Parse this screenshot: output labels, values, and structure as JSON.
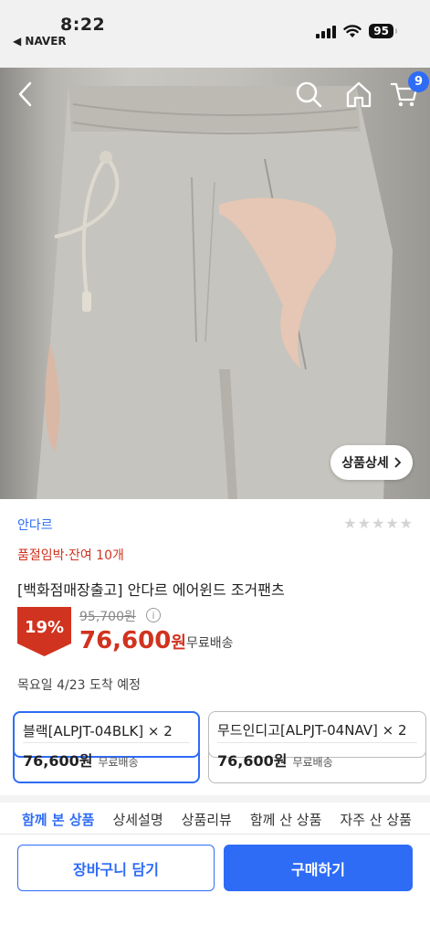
{
  "status_bar": {
    "time": "8:22",
    "back_app": "◀ NAVER",
    "battery": "95"
  },
  "nav": {
    "cart_count": "9",
    "detail_label": "상품상세"
  },
  "product": {
    "brand": "안다르",
    "stock_notice": "품절임박·잔여 10개",
    "title": "[백화점매장출고] 안다르 에어윈드 조거팬츠",
    "discount": "19%",
    "original_price": "95,700원",
    "sale_price_number": "76,600",
    "sale_price_unit": "원",
    "shipping": "무료배송",
    "delivery": "목요일 4/23 도착 예정"
  },
  "options": [
    {
      "name": "블랙[ALPJT-04BLK] × 2",
      "price": "76,600원",
      "shipping": "무료배송"
    },
    {
      "name": "무드인디고[ALPJT-04NAV] × 2",
      "price": "76,600원",
      "shipping": "무료배송"
    }
  ],
  "tabs": [
    "함께 본 상품",
    "상세설명",
    "상품리뷰",
    "함께 산 상품",
    "자주 산 상품"
  ],
  "actions": {
    "cart": "장바구니 담기",
    "buy": "구매하기"
  },
  "colors": {
    "accent": "#2e6cf6",
    "sale": "#d0331f"
  }
}
